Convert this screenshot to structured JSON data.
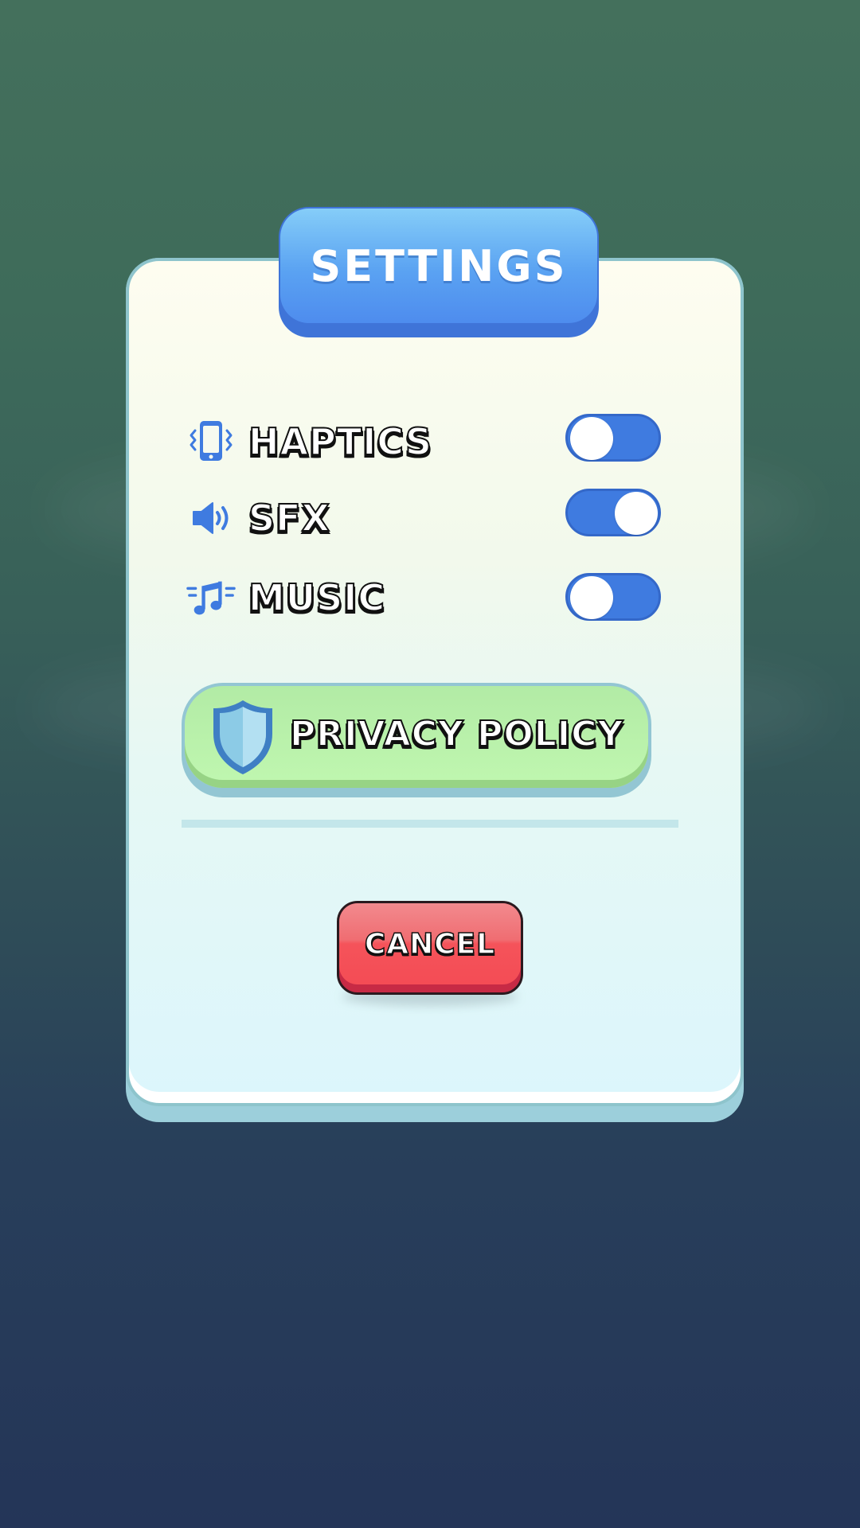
{
  "dialog": {
    "title": "SETTINGS"
  },
  "settings": [
    {
      "label": "HAPTICS",
      "icon": "phone-vibrate-icon",
      "enabled": false
    },
    {
      "label": "SFX",
      "icon": "speaker-icon",
      "enabled": true
    },
    {
      "label": "MUSIC",
      "icon": "music-note-icon",
      "enabled": false
    }
  ],
  "privacy": {
    "label": "PRIVACY POLICY",
    "icon": "shield-icon"
  },
  "cancel": {
    "label": "CANCEL"
  },
  "colors": {
    "accent_blue": "#3f7be0",
    "privacy_green": "#b8f1a8",
    "cancel_red": "#f44c55",
    "panel_bg": "#e6f8f4"
  }
}
